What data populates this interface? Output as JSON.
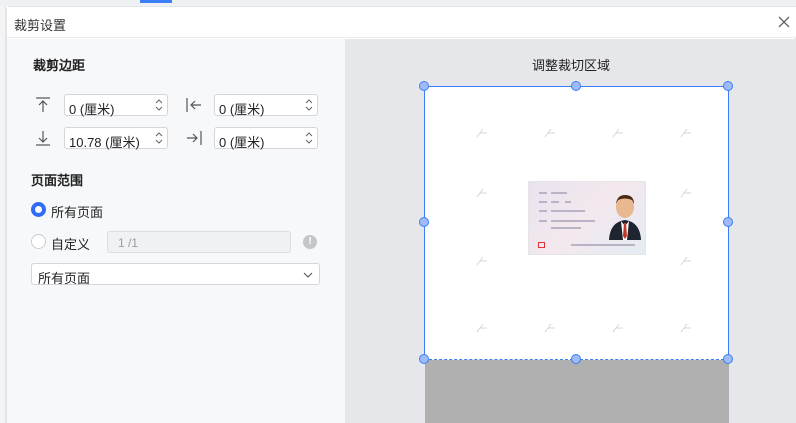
{
  "dialog": {
    "title": "裁剪设置"
  },
  "margins": {
    "section_title": "裁剪边距",
    "top": {
      "value": "0 (厘米)",
      "icon": "align-top-icon"
    },
    "left": {
      "value": "0 (厘米)",
      "icon": "align-left-icon"
    },
    "bottom": {
      "value": "10.78 (厘米)",
      "icon": "align-bottom-icon"
    },
    "right": {
      "value": "0 (厘米)",
      "icon": "align-right-icon"
    }
  },
  "page_range": {
    "section_title": "页面范围",
    "all_pages_label": "所有页面",
    "custom_label": "自定义",
    "custom_value": "1 /1",
    "info_icon": "!",
    "select_value": "所有页面",
    "selected": "all"
  },
  "preview": {
    "title": "调整裁切区域"
  },
  "colors": {
    "accent": "#3b7ef5",
    "radio_selected": "#2f6df6"
  }
}
